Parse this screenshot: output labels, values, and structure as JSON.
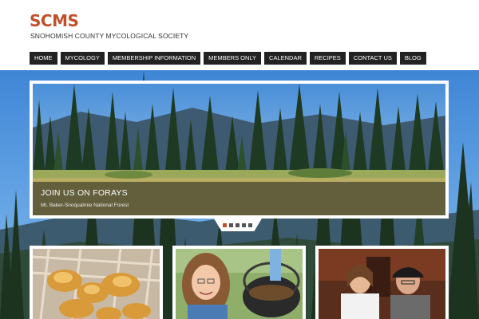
{
  "site": {
    "logo": "SCMS",
    "tagline": "SNOHOMISH COUNTY MYCOLOGICAL SOCIETY"
  },
  "nav": {
    "items": [
      {
        "label": "HOME"
      },
      {
        "label": "MYCOLOGY"
      },
      {
        "label": "MEMBERSHIP INFORMATION"
      },
      {
        "label": "MEMBERS ONLY"
      },
      {
        "label": "CALENDAR"
      },
      {
        "label": "RECIPES"
      },
      {
        "label": "CONTACT US"
      },
      {
        "label": "BLOG"
      }
    ]
  },
  "slider": {
    "title": "JOIN US ON FORAYS",
    "subtitle": "Mt. Baker-Snoqualmie National Forest",
    "dot_count": 5,
    "active_dot": 1
  },
  "colors": {
    "accent": "#c0502c",
    "nav_bg": "#222222"
  }
}
